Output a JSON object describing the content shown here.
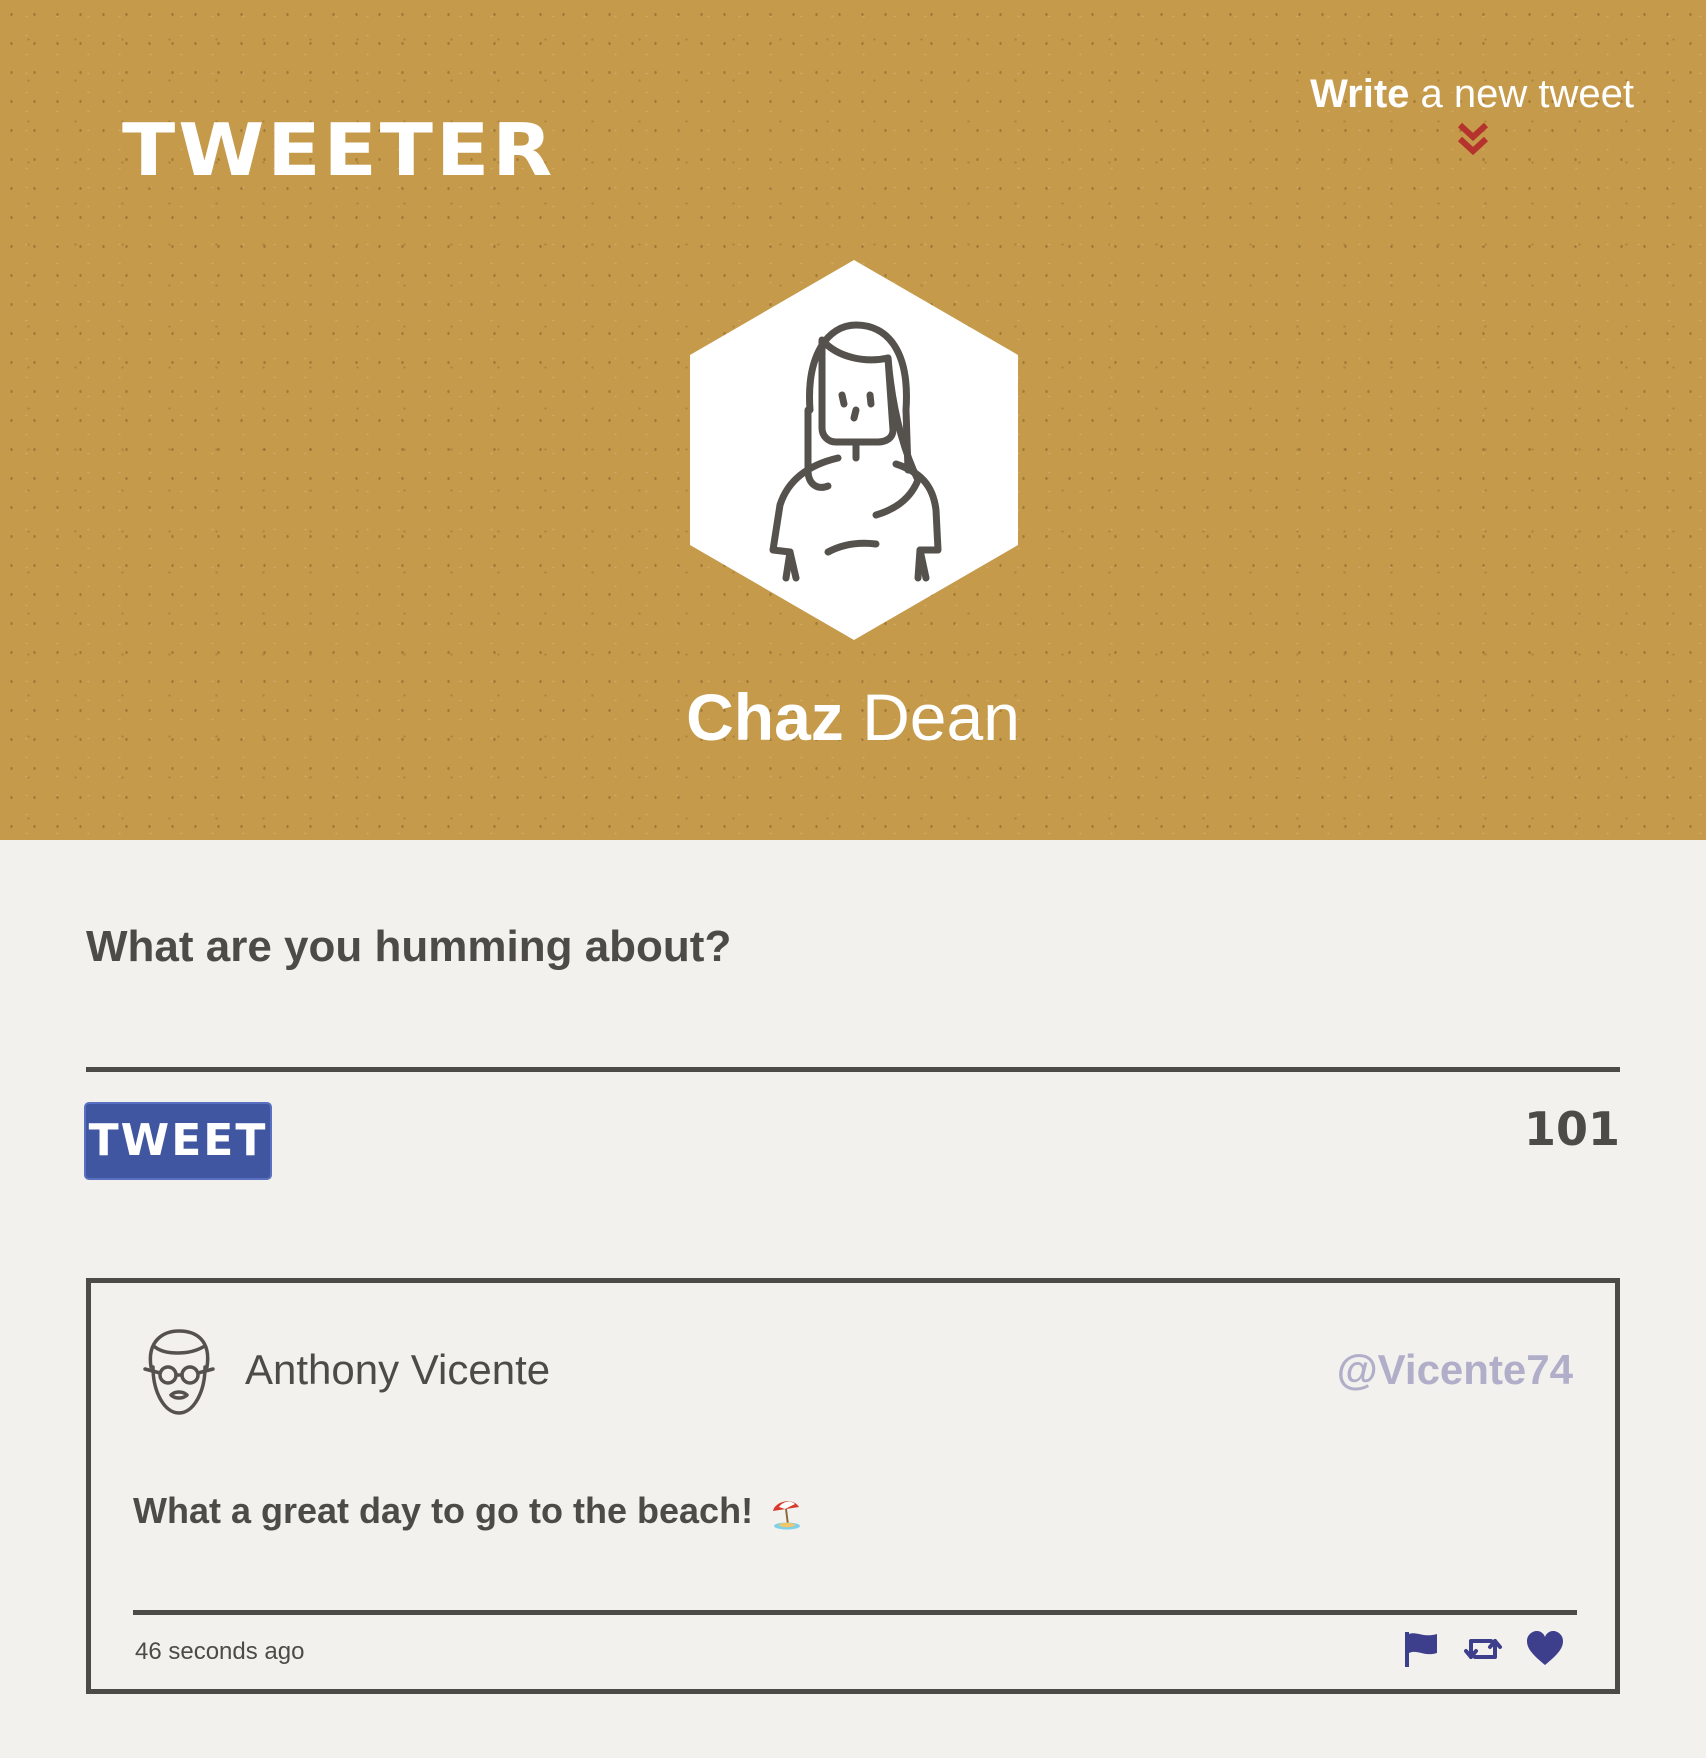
{
  "colors": {
    "header_bg": "#c59a4b",
    "page_bg": "#f2f1ed",
    "text": "#4d4b47",
    "button_bg": "#4056a0",
    "handle": "#b0aec8",
    "icon_blue": "#3d3f8c",
    "chevron_red": "#b5322d"
  },
  "header": {
    "logo": "TWEETER",
    "write_link": {
      "bold": "Write",
      "rest": " a new tweet"
    },
    "write_link_icon": "double-chevron-down-icon",
    "profile": {
      "first_name": "Chaz",
      "last_name": " Dean",
      "avatar_icon": "woman-avatar-icon"
    }
  },
  "compose": {
    "prompt": "What are you humming about?",
    "button_label": "TWEET",
    "char_counter": "101"
  },
  "tweets": [
    {
      "author": "Anthony Vicente",
      "handle": "@Vicente74",
      "avatar_icon": "man-with-glasses-avatar-icon",
      "text": "What a great day to go to the beach!",
      "emoji": "beach-umbrella-icon",
      "time": "46 seconds ago",
      "actions": [
        "flag-icon",
        "retweet-icon",
        "heart-icon"
      ]
    }
  ]
}
